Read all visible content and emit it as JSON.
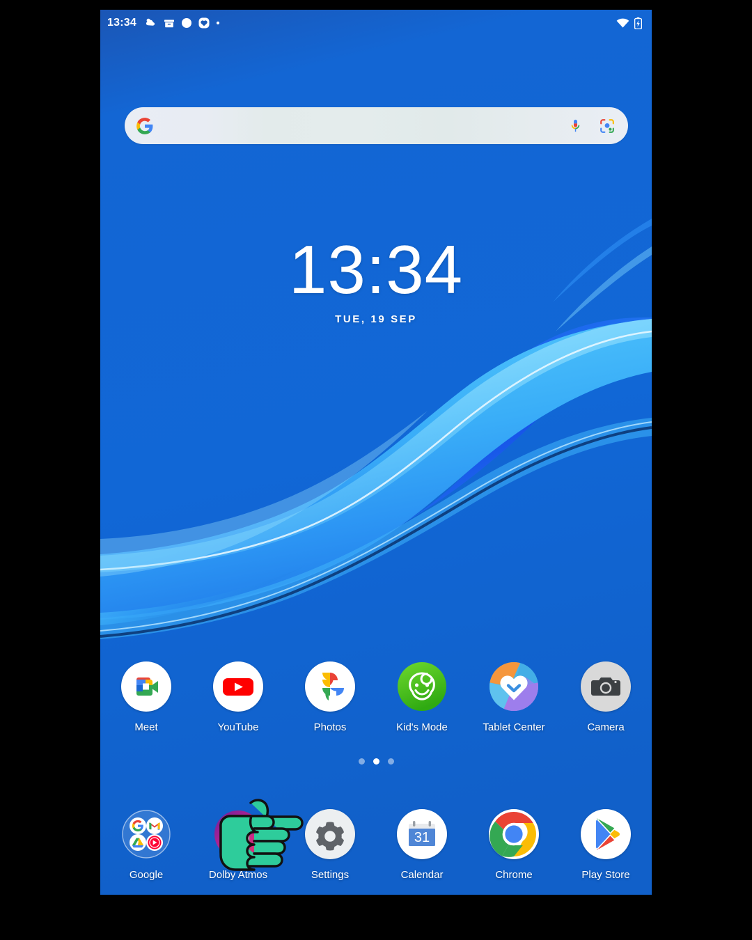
{
  "device": {
    "screen_background_color": "#1167d6",
    "accent_color": "#1a73e8"
  },
  "statusbar": {
    "clock": "13:34",
    "left_icons": [
      {
        "name": "weather-partly-cloudy-icon"
      },
      {
        "name": "archive-box-icon"
      },
      {
        "name": "circle-notification-icon"
      },
      {
        "name": "heart-app-notification-icon"
      },
      {
        "name": "more-notifications-dot-icon"
      }
    ],
    "right_icons": [
      {
        "name": "wifi-icon"
      },
      {
        "name": "battery-charging-icon"
      }
    ]
  },
  "search": {
    "placeholder": "",
    "value": "",
    "google_logo": "google-g-icon",
    "mic_icon": "microphone-icon",
    "lens_icon": "google-lens-icon"
  },
  "clock_widget": {
    "time": "13:34",
    "date": "TUE, 19 SEP"
  },
  "home_apps": [
    {
      "label": "Meet",
      "icon": "google-meet-icon"
    },
    {
      "label": "YouTube",
      "icon": "youtube-icon"
    },
    {
      "label": "Photos",
      "icon": "google-photos-icon"
    },
    {
      "label": "Kid's Mode",
      "icon": "kids-mode-icon"
    },
    {
      "label": "Tablet Center",
      "icon": "tablet-center-icon"
    },
    {
      "label": "Camera",
      "icon": "camera-icon"
    }
  ],
  "dock_apps": [
    {
      "label": "Google",
      "icon": "google-folder-icon"
    },
    {
      "label": "Dolby Atmos",
      "icon": "dolby-atmos-icon"
    },
    {
      "label": "Settings",
      "icon": "settings-gear-icon"
    },
    {
      "label": "Calendar",
      "icon": "google-calendar-icon",
      "day_number": "31"
    },
    {
      "label": "Chrome",
      "icon": "google-chrome-icon"
    },
    {
      "label": "Play Store",
      "icon": "google-play-store-icon"
    }
  ],
  "page_indicator": {
    "total": 3,
    "active_index": 1
  },
  "cursor": {
    "name": "pointing-hand-cursor",
    "color": "#2ecc9b"
  }
}
